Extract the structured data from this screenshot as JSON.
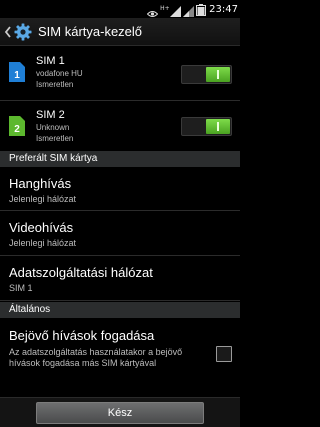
{
  "status_bar": {
    "network_type": "H+",
    "time": "23:47"
  },
  "header": {
    "title": "SIM kártya-kezelő",
    "icon": "gear-icon"
  },
  "sims": [
    {
      "name": "SIM 1",
      "operator": "vodafone HU",
      "status": "Ismeretlen",
      "icon_number": "1",
      "icon_color": "#1f7fd6",
      "enabled": true
    },
    {
      "name": "SIM 2",
      "operator": "Unknown",
      "status": "Ismeretlen",
      "icon_number": "2",
      "icon_color": "#5cb82e",
      "enabled": true
    }
  ],
  "sections": {
    "preferred": "Preferált SIM kártya",
    "general": "Általános"
  },
  "preferred_items": [
    {
      "title": "Hanghívás",
      "subtitle": "Jelenlegi hálózat"
    },
    {
      "title": "Videohívás",
      "subtitle": "Jelenlegi hálózat"
    },
    {
      "title": "Adatszolgáltatási hálózat",
      "subtitle": "SIM 1"
    }
  ],
  "general_items": [
    {
      "title": "Bejövő hívások fogadása",
      "description": "Az adatszolgáltatás használatakor a bejövő hívások fogadása más SIM kártyával",
      "checked": false
    }
  ],
  "footer": {
    "done_label": "Kész"
  },
  "colors": {
    "toggle_on": "#5cb82e",
    "section_bg": "#2b2d2e"
  }
}
